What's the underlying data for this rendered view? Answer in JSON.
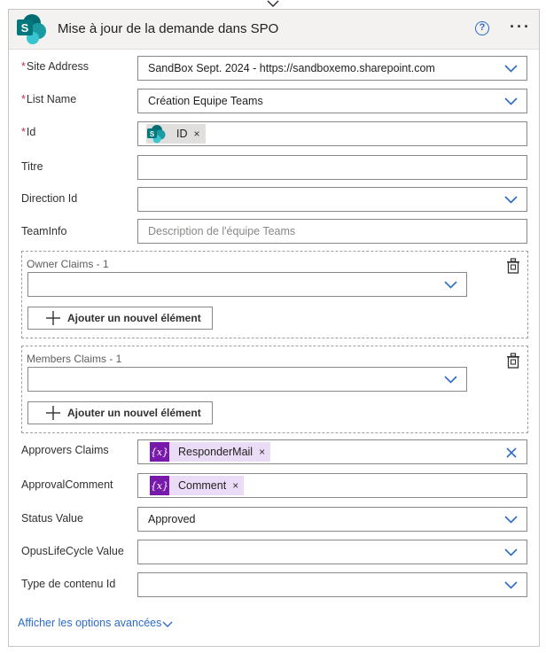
{
  "header": {
    "title": "Mise à jour de la demande dans SPO",
    "help_glyph": "?",
    "more_glyph": "···"
  },
  "fields": {
    "site_address": {
      "label": "Site Address",
      "value": "SandBox Sept. 2024 - https://sandboxemo.sharepoint.com"
    },
    "list_name": {
      "label": "List Name",
      "value": "Création Equipe Teams"
    },
    "id": {
      "label": "Id",
      "token": "ID"
    },
    "titre": {
      "label": "Titre"
    },
    "direction_id": {
      "label": "Direction Id"
    },
    "teaminfo": {
      "label": "TeamInfo",
      "placeholder": "Description de l'équipe Teams"
    },
    "approvers_claims": {
      "label": "Approvers Claims",
      "token": "ResponderMail"
    },
    "approval_comment": {
      "label": "ApprovalComment",
      "token": "Comment"
    },
    "status_value": {
      "label": "Status Value",
      "value": "Approved"
    },
    "opus_lifecycle": {
      "label": "OpusLifeCycle Value"
    },
    "type_contenu": {
      "label": "Type de contenu Id"
    }
  },
  "groups": {
    "owner": {
      "label": "Owner Claims - 1",
      "add_label": "Ajouter un nouvel élément"
    },
    "members": {
      "label": "Members Claims - 1",
      "add_label": "Ajouter un nouvel élément"
    }
  },
  "required_mark": "*",
  "token_remove": "×",
  "variable_glyph": "{x}",
  "advanced": {
    "label": "Afficher les options avancées"
  },
  "colors": {
    "accent": "#2b6bc9",
    "required": "#c4314b",
    "variable": "#7719aa",
    "sharepoint": "#038387"
  }
}
